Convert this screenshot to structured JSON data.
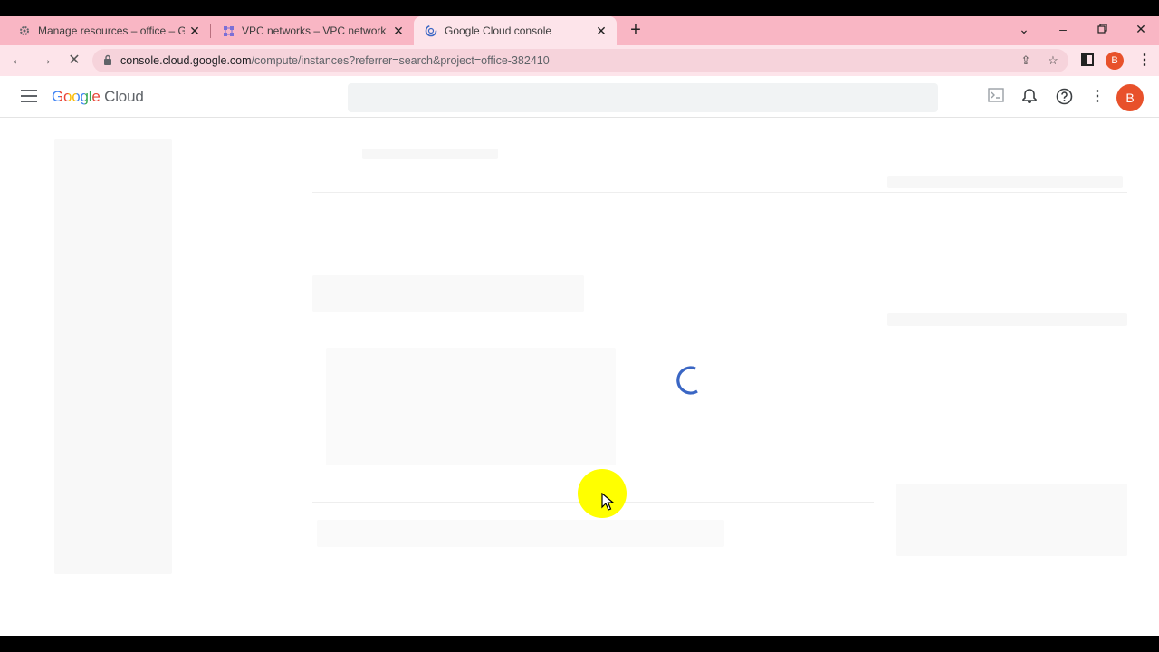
{
  "browser": {
    "tabs": [
      {
        "title": "Manage resources – office – Goo",
        "favicon": "gear-icon",
        "active": false
      },
      {
        "title": "VPC networks – VPC network – o",
        "favicon": "vpc-network-icon",
        "active": false
      },
      {
        "title": "Google Cloud console",
        "favicon": "loading-icon",
        "active": true
      }
    ],
    "url_host": "console.cloud.google.com",
    "url_path": "/compute/instances?referrer=search&project=office-382410",
    "profile_initial": "B"
  },
  "console": {
    "logo_google": "Google",
    "logo_cloud": "Cloud",
    "avatar_initial": "B"
  },
  "colors": {
    "tab_strip": "#f9b6c4",
    "active_tab": "#fde4ea",
    "avatar": "#e8512b",
    "spinner": "#3a66c4",
    "cursor_highlight": "#ffff00"
  }
}
